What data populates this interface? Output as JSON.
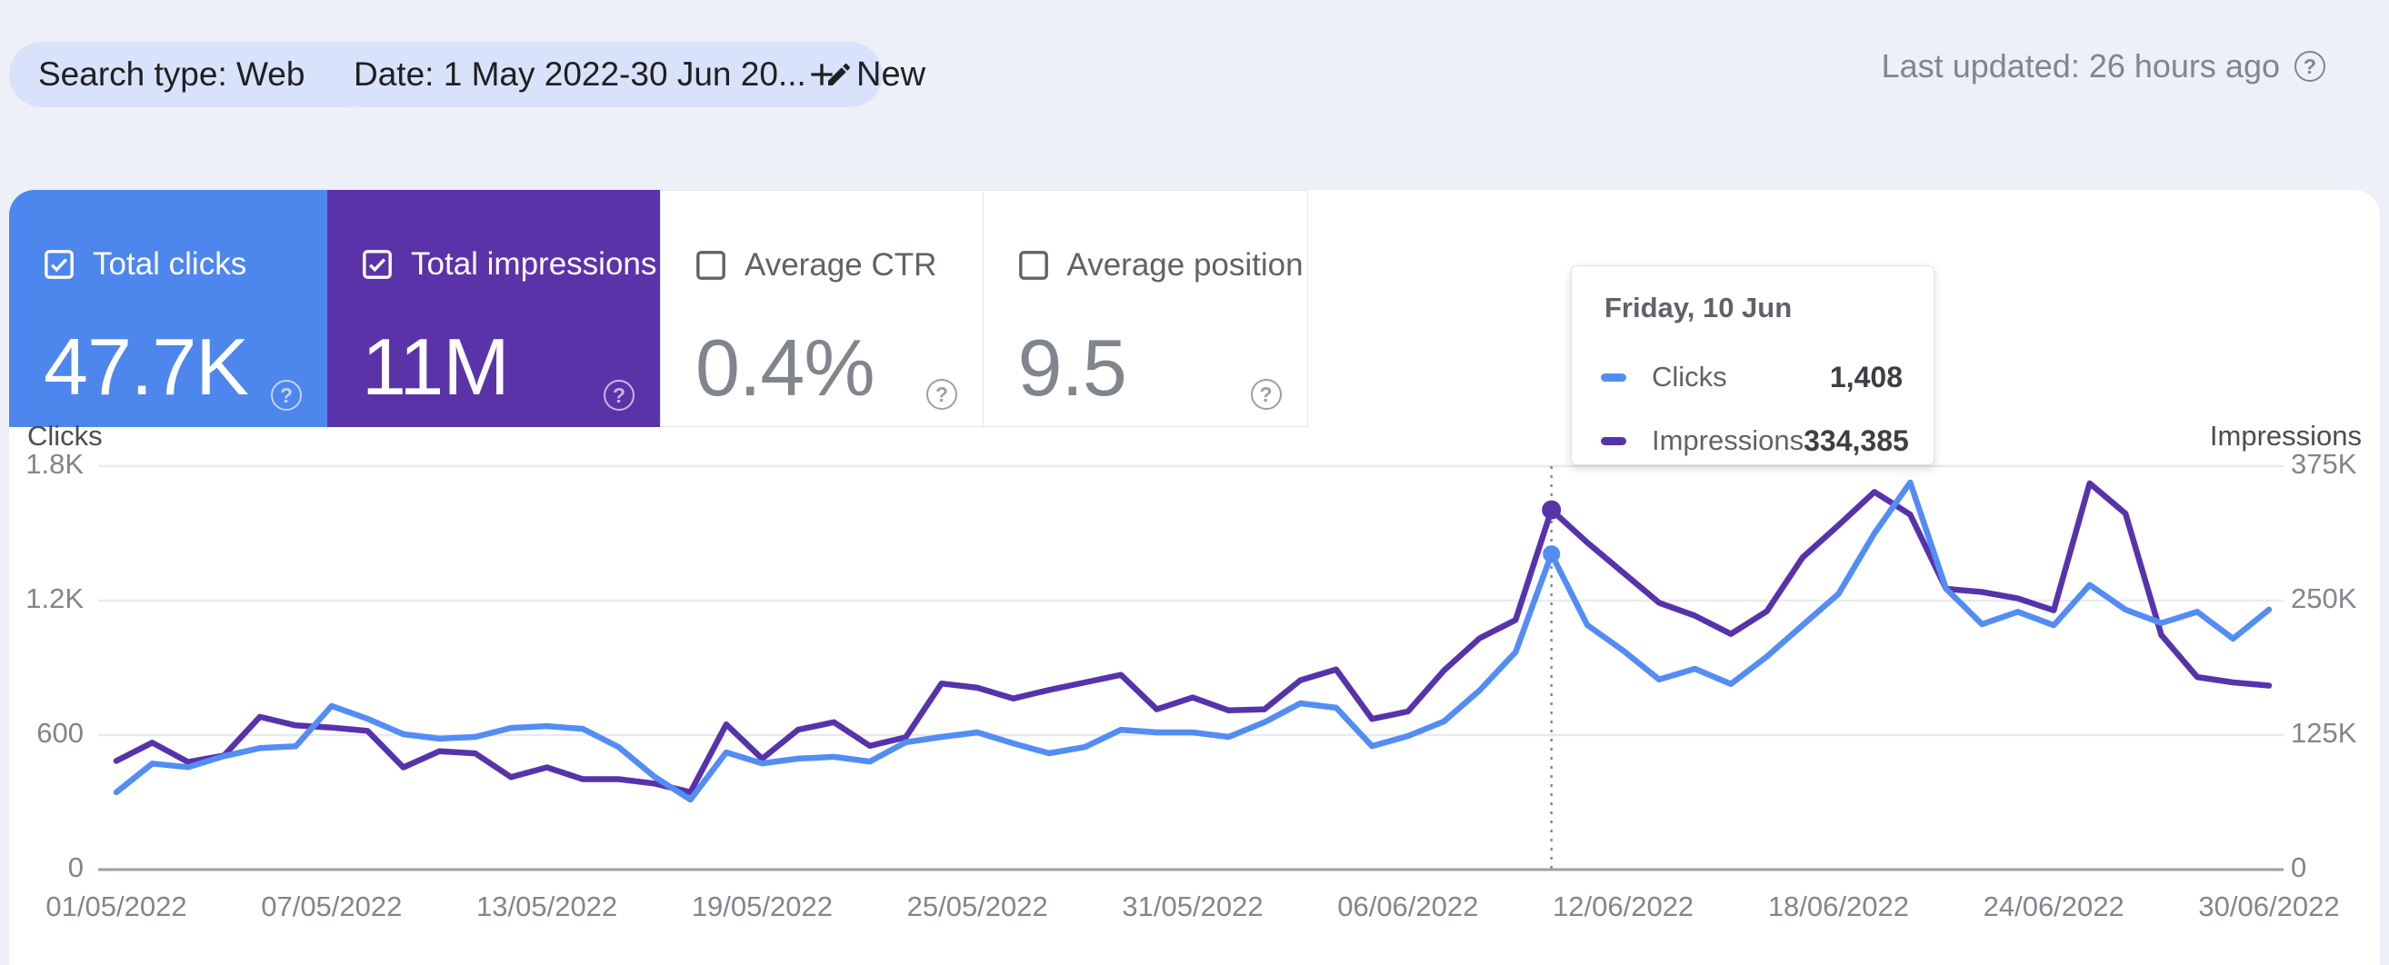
{
  "topbar": {
    "search_type_chip": "Search type: Web",
    "date_chip": "Date: 1 May 2022-30 Jun 20...",
    "new_button": "New",
    "last_updated": "Last updated: 26 hours ago"
  },
  "metric_cards": [
    {
      "label": "Total clicks",
      "value": "47.7K",
      "checked": true,
      "bg": "#4d86ec"
    },
    {
      "label": "Total impressions",
      "value": "11M",
      "checked": true,
      "bg": "#5b33a9"
    },
    {
      "label": "Average CTR",
      "value": "0.4%",
      "checked": false,
      "bg": "#ffffff"
    },
    {
      "label": "Average position",
      "value": "9.5",
      "checked": false,
      "bg": "#ffffff"
    }
  ],
  "tooltip": {
    "title": "Friday, 10 Jun",
    "rows": [
      {
        "label": "Clicks",
        "value": "1,408",
        "color": "#538df4"
      },
      {
        "label": "Impressions",
        "value": "334,385",
        "color": "#5733ab"
      }
    ]
  },
  "chart_data": {
    "type": "line",
    "x_start_date": "01/05/2022",
    "x_end_date": "30/06/2022",
    "x_tick_labels": [
      "01/05/2022",
      "07/05/2022",
      "13/05/2022",
      "19/05/2022",
      "25/05/2022",
      "31/05/2022",
      "06/06/2022",
      "12/06/2022",
      "18/06/2022",
      "24/06/2022",
      "30/06/2022"
    ],
    "x_tick_indices": [
      0,
      6,
      12,
      18,
      24,
      30,
      36,
      42,
      48,
      54,
      60
    ],
    "y_left": {
      "label": "Clicks",
      "ticks": [
        "1.8K",
        "1.2K",
        "600",
        "0"
      ],
      "tick_values": [
        1800,
        1200,
        600,
        0
      ],
      "max": 1800
    },
    "y_right": {
      "label": "Impressions",
      "ticks": [
        "375K",
        "250K",
        "125K",
        "0"
      ],
      "tick_values": [
        375000,
        250000,
        125000,
        0
      ],
      "max": 375000
    },
    "grid": true,
    "legend_position": "tooltip-only",
    "series": [
      {
        "name": "Clicks",
        "axis": "left",
        "color": "#538df4",
        "values": [
          345,
          473,
          457,
          506,
          542,
          550,
          730,
          673,
          604,
          584,
          592,
          632,
          640,
          628,
          547,
          414,
          312,
          523,
          474,
          495,
          503,
          482,
          568,
          592,
          612,
          563,
          519,
          547,
          624,
          612,
          612,
          592,
          657,
          742,
          722,
          551,
          596,
          661,
          800,
          970,
          1408,
          1091,
          977,
          848,
          896,
          828,
          950,
          1090,
          1230,
          1500,
          1727,
          1253,
          1095,
          1150,
          1090,
          1270,
          1160,
          1100,
          1150,
          1030,
          1160
        ]
      },
      {
        "name": "Impressions",
        "axis": "right",
        "color": "#5733ab",
        "values": [
          101000,
          118000,
          100000,
          106000,
          142000,
          134000,
          132000,
          129000,
          95000,
          110000,
          108000,
          86000,
          95000,
          84000,
          84000,
          80000,
          72000,
          135000,
          103000,
          130000,
          137000,
          115000,
          123000,
          173000,
          169000,
          159000,
          167000,
          174000,
          181000,
          149000,
          160000,
          148000,
          149000,
          176000,
          186000,
          140000,
          147000,
          185000,
          215000,
          232000,
          334385,
          304000,
          276000,
          248000,
          236000,
          219000,
          240000,
          290000,
          320000,
          351000,
          330000,
          261000,
          258000,
          252000,
          241000,
          359000,
          331000,
          218000,
          179000,
          174000,
          171000
        ]
      }
    ],
    "highlight": {
      "index": 40,
      "date": "Friday, 10 Jun",
      "clicks": 1408,
      "impressions": 334385
    }
  },
  "colors": {
    "page_bg": "#eef0f8",
    "chip_bg": "#d9e2fb",
    "clicks_accent": "#4d86ec",
    "impressions_accent": "#5b33a9",
    "clicks_line": "#538df4",
    "impressions_line": "#5733ab",
    "gridline": "#e9eaed",
    "axis_line": "#9aa0a6",
    "muted_text": "#80868b"
  }
}
